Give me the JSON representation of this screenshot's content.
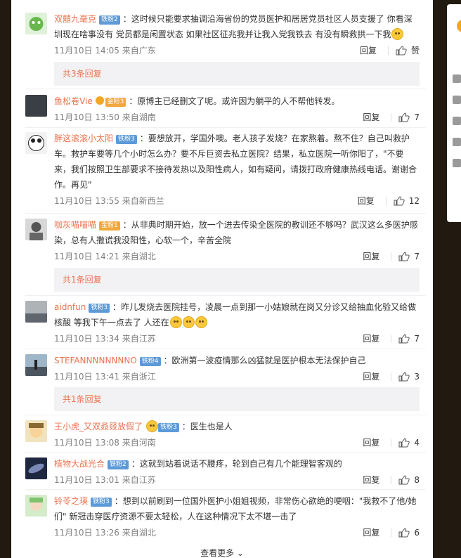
{
  "comments": [
    {
      "user": "双囍九毫克",
      "badge": "铁粉2",
      "text": "：这时候只能要求抽调沿海省份的党员医护和居居党员社区人员支援了 你看深圳现在啥事没有 党员都是闲置状态 如果社区征兆我并让我入党我铁去 有没有瞬救拱一下我",
      "time": "11月10日 14:05 来自广东",
      "reply": "回复",
      "likes": "赞"
    },
    {
      "user": "鱼松卷Vie",
      "badge": "金粉3",
      "text": "：原博主已经删文了呢。或许因为躺平的人不帮他转发。",
      "time": "11月10日 13:50 来自湖南",
      "reply": "回复",
      "likes": "7"
    },
    {
      "user": "胖这滚滚小太阳",
      "badge": "铁粉3",
      "text": "：要想放开，学国外噢。老人孩子发烧？在家熬着。熬不住？自己叫救护车。救护车要等几个小时怎么办？要不斥巨资去私立医院？结果，私立医院一听你阳了，\"不要来，我们按照卫生部要求不接待发热以及阳性病人，如有疑问，请拨打政府健康热线电话。谢谢合作。再见\"",
      "time": "11月10日 13:55 来自新西兰",
      "reply": "回复",
      "likes": "12"
    },
    {
      "user": "咖灰喵喵喵",
      "badge": "金粉1",
      "text": "：从非典时期开始，放一个进去传染全医院的教训还不够吗？武汉这么多医护感染，总有人撒谎我没阳性，心软一个，辛苦全院",
      "time": "11月10日 14:21 来自湖北",
      "reply": "回复",
      "likes": "7"
    },
    {
      "user": "aidnfun",
      "badge": "铁粉3",
      "text": "：昨儿发烧去医院挂号，凌晨一点到那一小姑娘就在岗又分诊又给抽血化验又给做核酸 等我下午一点去了 人还在",
      "time": "11月10日 13:34 来自江苏",
      "reply": "回复",
      "likes": "7"
    },
    {
      "user": "STEFANNNNNNNNO",
      "badge": "铁粉4",
      "text": "：欧洲第一波疫情那么凶猛就是医护根本无法保护自己",
      "time": "11月10日 13:41 来自浙江",
      "reply": "回复",
      "likes": "3"
    },
    {
      "user": "王小虎_又双叒叕放假了",
      "badge": "铁粉3",
      "text": "：医生也是人",
      "time": "11月10日 13:08 来自河南",
      "reply": "回复",
      "likes": "4"
    },
    {
      "user": "植物大战光合",
      "badge": "铁粉2",
      "text": "：这就到站着说话不腰疼，轮到自己有几个能理智客观的",
      "time": "11月10日 13:01 来自江苏",
      "reply": "回复",
      "likes": "8"
    },
    {
      "user": "铃苓之瑛",
      "badge": "铁粉3",
      "text": "：想到以前刷到一位国外医护小姐姐视频，非常伤心欲绝的哽咽：\"我救不了他/她们\" 新冠击穿医疗资源不要太轻松，人在这种情况下太不堪一击了",
      "time": "11月10日 13:26 来自湖北",
      "reply": "回复",
      "likes": "6"
    }
  ],
  "reply_links": [
    "共3条回复",
    "共1条回复",
    "共1条回复"
  ],
  "load_more": "查看更多 ⌄",
  "colors": {
    "username": "#eb7350",
    "badge": "#5c9ad8",
    "gold_badge": "#f3a73a"
  }
}
